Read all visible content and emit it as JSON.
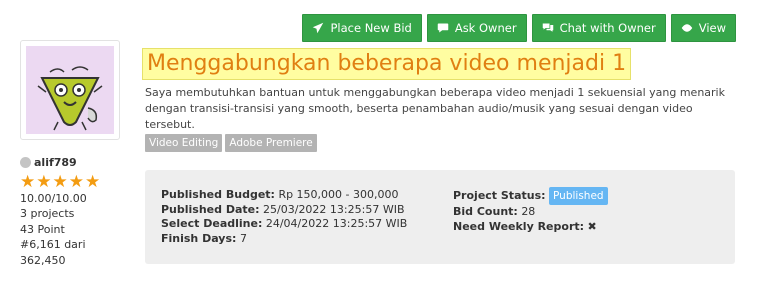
{
  "actions": {
    "place_bid": "Place New Bid",
    "ask_owner": "Ask Owner",
    "chat_owner": "Chat with Owner",
    "view": "View"
  },
  "owner": {
    "username": "alif789",
    "rating_stars": 5,
    "rating": "10.00/10.00",
    "projects": "3 projects",
    "points": "43 Point",
    "rank": "#6,161 dari",
    "rank_total": "362,450"
  },
  "project": {
    "title": "Menggabungkan beberapa video menjadi 1",
    "description": "Saya membutuhkan bantuan untuk menggabungkan beberapa video menjadi 1 sekuensial yang menarik dengan transisi-transisi yang smooth, beserta penambahan audio/musik yang sesuai dengan video tersebut.",
    "tags": [
      "Video Editing",
      "Adobe Premiere"
    ]
  },
  "details": {
    "budget_label": "Published Budget:",
    "budget_value": "Rp 150,000 - 300,000",
    "date_label": "Published Date:",
    "date_value": "25/03/2022 13:25:57 WIB",
    "deadline_label": "Select Deadline:",
    "deadline_value": "24/04/2022 13:25:57 WIB",
    "finish_label": "Finish Days:",
    "finish_value": "7",
    "status_label": "Project Status:",
    "status_value": "Published",
    "bid_label": "Bid Count:",
    "bid_value": "28",
    "report_label": "Need Weekly Report:",
    "report_value": "✖"
  },
  "colors": {
    "button_green": "#36a64a",
    "title_text": "#e07f12",
    "title_highlight": "#fffda1",
    "star": "#f39c12",
    "status_badge": "#65b6f3"
  }
}
